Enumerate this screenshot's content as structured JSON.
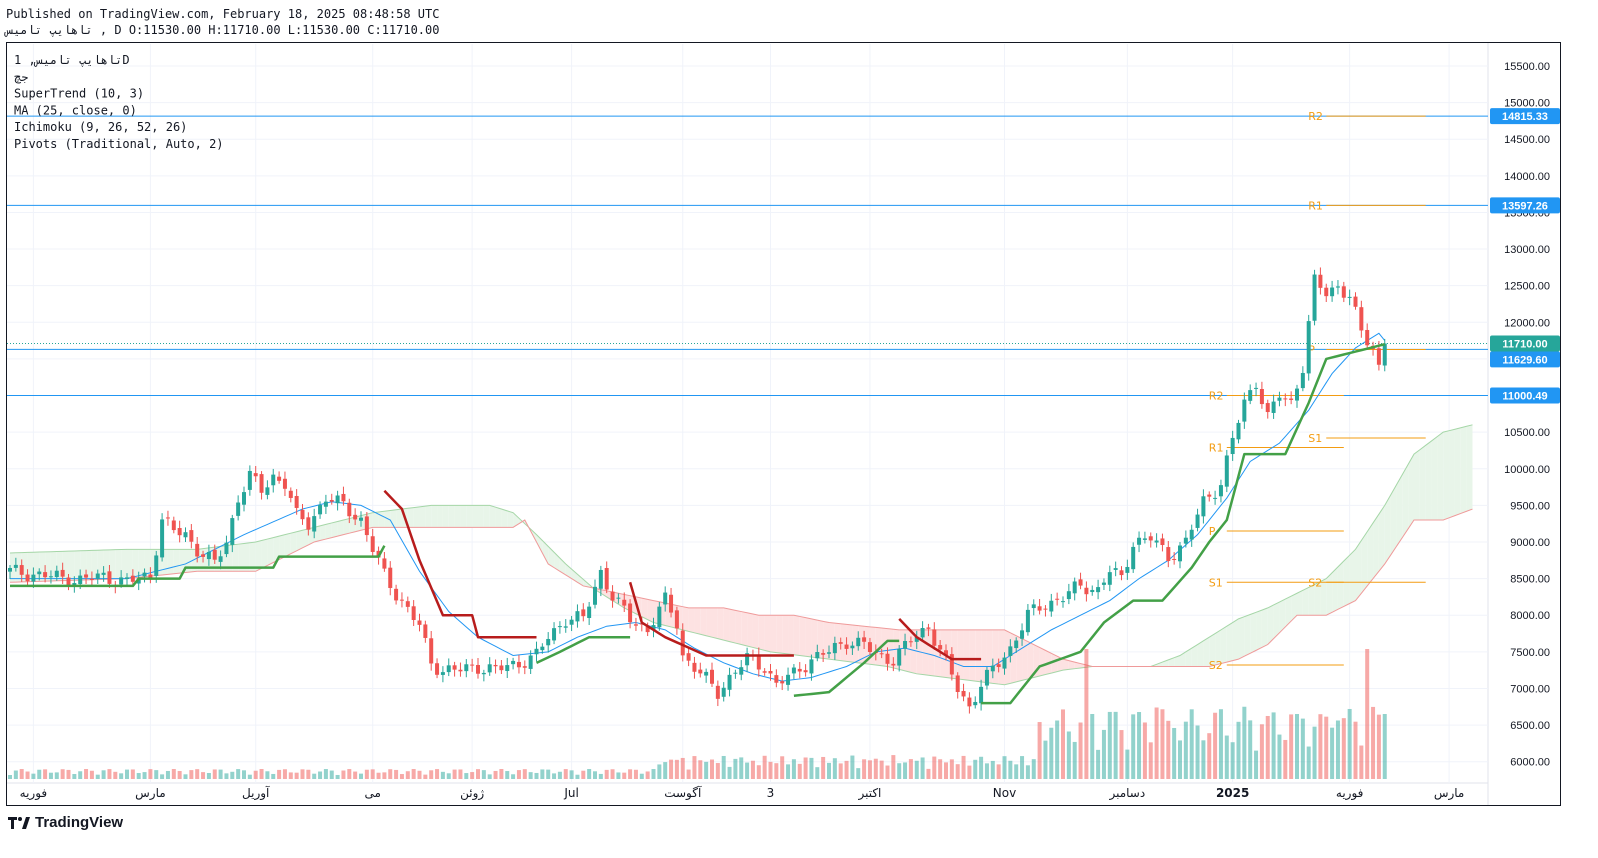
{
  "header": {
    "published": "Published on TradingView.com, February 18, 2025 08:48:58 UTC",
    "symbol_line": "تاهایپ تامیس , D O:11530.00 H:11710.00 L:11530.00 C:11710.00"
  },
  "legend": [
    "تاهایپ تامیس, 1D",
    "جچ",
    "SuperTrend (10, 3)",
    "MA (25, close, 0)",
    "Ichimoku (9, 26, 52, 26)",
    "Pivots (Traditional, Auto, 2)"
  ],
  "footer": {
    "brand": "TradingView"
  },
  "colors": {
    "up": "#26a69a",
    "down": "#ef5350",
    "supertrend_up": "#43a047",
    "supertrend_down": "#b71c1c",
    "ma": "#2196f3",
    "pivot": "#f39c12",
    "cloud_green": "#e8f5e9",
    "cloud_red": "#fde2e2",
    "hline": "#2196f3"
  },
  "chart_data": {
    "type": "candlestick",
    "title": "",
    "yticks": [
      15500,
      15000,
      14500,
      14000,
      13500,
      13000,
      12500,
      12000,
      11500,
      11000,
      10500,
      10000,
      9500,
      9000,
      8500,
      8000,
      7500,
      7000,
      6500,
      6000
    ],
    "ytick_labels": [
      "15500.00",
      "15000.00",
      "14500.00",
      "14000.00",
      "13500.00",
      "13000.00",
      "12500.00",
      "12000.00",
      "11500.00",
      "11000.00",
      "10500.00",
      "10000.00",
      "9500.00",
      "9000.00",
      "8500.00",
      "8000.00",
      "7500.00",
      "7000.00",
      "6500.00",
      "6000.00"
    ],
    "ylim": [
      5750,
      15800
    ],
    "xticks": [
      {
        "label": "فوریه",
        "i": 4
      },
      {
        "label": "مارس",
        "i": 24
      },
      {
        "label": "آوریل",
        "i": 42
      },
      {
        "label": "می",
        "i": 62
      },
      {
        "label": "ژوئن",
        "i": 79
      },
      {
        "label": "Jul",
        "i": 96
      },
      {
        "label": "آگوست",
        "i": 115
      },
      {
        "label": "3",
        "i": 130
      },
      {
        "label": "اکتبر",
        "i": 147
      },
      {
        "label": "Nov",
        "i": 170
      },
      {
        "label": "دسامبر",
        "i": 191
      },
      {
        "label": "2025",
        "i": 209
      },
      {
        "label": "فوریه",
        "i": 229
      },
      {
        "label": "مارس",
        "i": 246
      }
    ],
    "horizontal_levels": [
      {
        "value": 14815.33,
        "label": "14815.33"
      },
      {
        "value": 13597.26,
        "label": "13597.26"
      },
      {
        "value": 11629.6,
        "label": "11629.60"
      },
      {
        "value": 11000.49,
        "label": "11000.49"
      }
    ],
    "last_price": {
      "value": 11710.0,
      "label": "11710.00"
    },
    "pivots": [
      {
        "label": "R2",
        "value": 14815,
        "from": 225,
        "to": 242
      },
      {
        "label": "R1",
        "value": 13597,
        "from": 225,
        "to": 242
      },
      {
        "label": "P",
        "value": 11629,
        "from": 225,
        "to": 242
      },
      {
        "label": "S1",
        "value": 10420,
        "from": 225,
        "to": 242
      },
      {
        "label": "S2",
        "value": 8450,
        "from": 225,
        "to": 242
      },
      {
        "label": "R2",
        "value": 11000,
        "from": 208,
        "to": 228
      },
      {
        "label": "R1",
        "value": 10290,
        "from": 208,
        "to": 228
      },
      {
        "label": "P",
        "value": 9150,
        "from": 208,
        "to": 228
      },
      {
        "label": "S1",
        "value": 8450,
        "from": 208,
        "to": 228
      },
      {
        "label": "S2",
        "value": 7320,
        "from": 208,
        "to": 228
      }
    ],
    "close_anchors": [
      [
        0,
        8600
      ],
      [
        4,
        8560
      ],
      [
        8,
        8520
      ],
      [
        12,
        8480
      ],
      [
        16,
        8530
      ],
      [
        20,
        8450
      ],
      [
        24,
        8550
      ],
      [
        26,
        9300
      ],
      [
        28,
        9150
      ],
      [
        30,
        9100
      ],
      [
        32,
        8900
      ],
      [
        35,
        8700
      ],
      [
        37,
        9000
      ],
      [
        39,
        9600
      ],
      [
        41,
        9900
      ],
      [
        43,
        9700
      ],
      [
        45,
        9900
      ],
      [
        47,
        9800
      ],
      [
        49,
        9350
      ],
      [
        51,
        9250
      ],
      [
        54,
        9600
      ],
      [
        57,
        9500
      ],
      [
        60,
        9300
      ],
      [
        62,
        8900
      ],
      [
        64,
        8550
      ],
      [
        66,
        8300
      ],
      [
        70,
        7850
      ],
      [
        72,
        7350
      ],
      [
        74,
        7250
      ],
      [
        77,
        7250
      ],
      [
        80,
        7300
      ],
      [
        83,
        7250
      ],
      [
        87,
        7350
      ],
      [
        90,
        7450
      ],
      [
        92,
        7700
      ],
      [
        95,
        7950
      ],
      [
        98,
        7950
      ],
      [
        101,
        8600
      ],
      [
        103,
        8250
      ],
      [
        106,
        7950
      ],
      [
        109,
        7800
      ],
      [
        112,
        8200
      ],
      [
        114,
        7900
      ],
      [
        115,
        7450
      ],
      [
        118,
        7200
      ],
      [
        121,
        6950
      ],
      [
        123,
        7150
      ],
      [
        126,
        7400
      ],
      [
        129,
        7300
      ],
      [
        131,
        7050
      ],
      [
        134,
        7200
      ],
      [
        137,
        7400
      ],
      [
        140,
        7500
      ],
      [
        143,
        7650
      ],
      [
        146,
        7600
      ],
      [
        148,
        7450
      ],
      [
        151,
        7400
      ],
      [
        154,
        7650
      ],
      [
        157,
        7850
      ],
      [
        160,
        7350
      ],
      [
        162,
        7000
      ],
      [
        164,
        6750
      ],
      [
        166,
        7050
      ],
      [
        169,
        7350
      ],
      [
        171,
        7550
      ],
      [
        174,
        8000
      ],
      [
        177,
        8150
      ],
      [
        180,
        8250
      ],
      [
        183,
        8400
      ],
      [
        186,
        8350
      ],
      [
        188,
        8600
      ],
      [
        190,
        8500
      ],
      [
        192,
        9000
      ],
      [
        195,
        9050
      ],
      [
        198,
        8800
      ],
      [
        201,
        9000
      ],
      [
        204,
        9550
      ],
      [
        207,
        9800
      ],
      [
        209,
        10400
      ],
      [
        211,
        10900
      ],
      [
        213,
        11200
      ],
      [
        215,
        10700
      ],
      [
        217,
        11000
      ],
      [
        219,
        10900
      ],
      [
        221,
        11400
      ],
      [
        223,
        12550
      ],
      [
        225,
        12400
      ],
      [
        227,
        12500
      ],
      [
        229,
        12350
      ],
      [
        231,
        11850
      ],
      [
        233,
        11650
      ],
      [
        234,
        11400
      ],
      [
        235,
        11710
      ]
    ],
    "supertrend_segments": [
      {
        "trend": "up",
        "points": [
          [
            0,
            8400
          ],
          [
            21,
            8400
          ],
          [
            22,
            8500
          ],
          [
            29,
            8500
          ],
          [
            30,
            8650
          ],
          [
            45,
            8650
          ],
          [
            46,
            8800
          ],
          [
            63,
            8800
          ],
          [
            64,
            8950
          ]
        ]
      },
      {
        "trend": "down",
        "points": [
          [
            64,
            9700
          ],
          [
            67,
            9450
          ],
          [
            70,
            8750
          ],
          [
            74,
            8000
          ],
          [
            79,
            8000
          ],
          [
            80,
            7700
          ],
          [
            90,
            7700
          ]
        ]
      },
      {
        "trend": "up",
        "points": [
          [
            90,
            7350
          ],
          [
            94,
            7500
          ],
          [
            99,
            7700
          ],
          [
            106,
            7700
          ]
        ]
      },
      {
        "trend": "down",
        "points": [
          [
            106,
            8450
          ],
          [
            108,
            7900
          ],
          [
            112,
            7700
          ],
          [
            119,
            7450
          ],
          [
            134,
            7450
          ]
        ]
      },
      {
        "trend": "up",
        "points": [
          [
            134,
            6900
          ],
          [
            140,
            6950
          ],
          [
            146,
            7350
          ],
          [
            150,
            7650
          ],
          [
            152,
            7650
          ]
        ]
      },
      {
        "trend": "down",
        "points": [
          [
            152,
            7950
          ],
          [
            155,
            7700
          ],
          [
            158,
            7550
          ],
          [
            161,
            7400
          ],
          [
            166,
            7400
          ]
        ]
      },
      {
        "trend": "up",
        "points": [
          [
            166,
            6800
          ],
          [
            171,
            6800
          ],
          [
            176,
            7300
          ],
          [
            183,
            7500
          ],
          [
            187,
            7900
          ],
          [
            192,
            8200
          ],
          [
            197,
            8200
          ],
          [
            202,
            8650
          ],
          [
            205,
            9000
          ],
          [
            208,
            9300
          ],
          [
            211,
            10200
          ],
          [
            218,
            10200
          ],
          [
            222,
            10900
          ],
          [
            225,
            11500
          ],
          [
            235,
            11700
          ]
        ]
      }
    ],
    "ma_anchors": [
      [
        0,
        8500
      ],
      [
        10,
        8500
      ],
      [
        20,
        8500
      ],
      [
        30,
        8700
      ],
      [
        40,
        9100
      ],
      [
        50,
        9450
      ],
      [
        55,
        9550
      ],
      [
        60,
        9500
      ],
      [
        65,
        9300
      ],
      [
        70,
        8600
      ],
      [
        75,
        8050
      ],
      [
        80,
        7700
      ],
      [
        86,
        7450
      ],
      [
        92,
        7500
      ],
      [
        97,
        7700
      ],
      [
        102,
        7850
      ],
      [
        107,
        7900
      ],
      [
        112,
        7800
      ],
      [
        117,
        7550
      ],
      [
        122,
        7350
      ],
      [
        127,
        7200
      ],
      [
        132,
        7100
      ],
      [
        137,
        7150
      ],
      [
        143,
        7300
      ],
      [
        148,
        7500
      ],
      [
        153,
        7550
      ],
      [
        158,
        7450
      ],
      [
        163,
        7300
      ],
      [
        168,
        7300
      ],
      [
        173,
        7550
      ],
      [
        178,
        7800
      ],
      [
        183,
        8000
      ],
      [
        188,
        8200
      ],
      [
        193,
        8500
      ],
      [
        198,
        8750
      ],
      [
        203,
        9100
      ],
      [
        208,
        9600
      ],
      [
        212,
        10100
      ],
      [
        217,
        10350
      ],
      [
        222,
        10800
      ],
      [
        226,
        11300
      ],
      [
        230,
        11650
      ],
      [
        234,
        11850
      ],
      [
        235,
        11750
      ]
    ],
    "span_a": [
      [
        0,
        8850
      ],
      [
        20,
        8900
      ],
      [
        32,
        8900
      ],
      [
        42,
        9000
      ],
      [
        52,
        9200
      ],
      [
        62,
        9400
      ],
      [
        72,
        9500
      ],
      [
        82,
        9500
      ],
      [
        86,
        9400
      ],
      [
        90,
        9100
      ],
      [
        95,
        8700
      ],
      [
        100,
        8350
      ],
      [
        105,
        8100
      ],
      [
        110,
        7900
      ],
      [
        115,
        7800
      ],
      [
        120,
        7700
      ],
      [
        125,
        7600
      ],
      [
        130,
        7500
      ],
      [
        135,
        7450
      ],
      [
        140,
        7400
      ],
      [
        145,
        7350
      ],
      [
        150,
        7300
      ],
      [
        155,
        7200
      ],
      [
        160,
        7150
      ],
      [
        165,
        7100
      ],
      [
        170,
        7050
      ],
      [
        175,
        7150
      ],
      [
        180,
        7250
      ],
      [
        185,
        7300
      ],
      [
        190,
        7300
      ],
      [
        195,
        7300
      ],
      [
        200,
        7450
      ],
      [
        205,
        7700
      ],
      [
        210,
        7950
      ],
      [
        215,
        8100
      ],
      [
        220,
        8300
      ],
      [
        225,
        8500
      ],
      [
        230,
        8900
      ],
      [
        235,
        9500
      ],
      [
        240,
        10200
      ],
      [
        245,
        10500
      ],
      [
        250,
        10600
      ]
    ],
    "span_b": [
      [
        0,
        8450
      ],
      [
        20,
        8500
      ],
      [
        32,
        8600
      ],
      [
        42,
        8600
      ],
      [
        52,
        9000
      ],
      [
        62,
        9200
      ],
      [
        70,
        9200
      ],
      [
        80,
        9200
      ],
      [
        86,
        9200
      ],
      [
        88,
        9300
      ],
      [
        92,
        8700
      ],
      [
        98,
        8400
      ],
      [
        104,
        8300
      ],
      [
        110,
        8200
      ],
      [
        116,
        8100
      ],
      [
        122,
        8100
      ],
      [
        128,
        8000
      ],
      [
        134,
        8000
      ],
      [
        140,
        7900
      ],
      [
        146,
        7850
      ],
      [
        152,
        7800
      ],
      [
        158,
        7800
      ],
      [
        164,
        7800
      ],
      [
        170,
        7800
      ],
      [
        175,
        7600
      ],
      [
        180,
        7400
      ],
      [
        185,
        7300
      ],
      [
        190,
        7300
      ],
      [
        195,
        7300
      ],
      [
        200,
        7300
      ],
      [
        205,
        7300
      ],
      [
        210,
        7400
      ],
      [
        215,
        7600
      ],
      [
        220,
        8000
      ],
      [
        225,
        8000
      ],
      [
        230,
        8200
      ],
      [
        235,
        8700
      ],
      [
        240,
        9300
      ],
      [
        245,
        9300
      ],
      [
        250,
        9450
      ]
    ],
    "volume_spikes": [
      [
        184,
        1.0
      ],
      [
        185,
        0.5
      ],
      [
        196,
        0.55
      ],
      [
        220,
        0.5
      ],
      [
        227,
        0.45
      ],
      [
        232,
        1.0
      ],
      [
        235,
        0.5
      ]
    ]
  }
}
